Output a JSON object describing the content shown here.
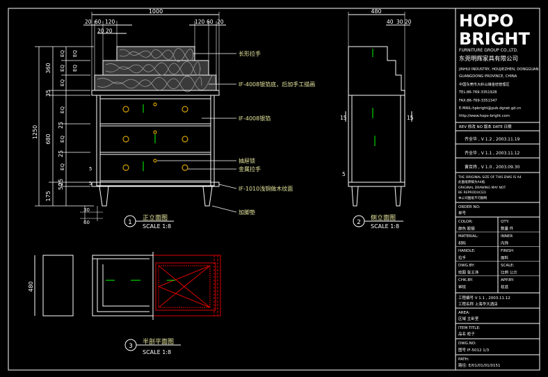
{
  "dims": {
    "front_top": "1000",
    "front_top_sub": [
      "20",
      "60",
      "120",
      "120",
      "60",
      "20"
    ],
    "front_top_sub2": [
      "20",
      "20"
    ],
    "front_left": [
      "EQ",
      "EQ",
      "EQ",
      "EQ",
      "EQ",
      "EQ",
      "EQ",
      "EQ"
    ],
    "front_left2": [
      "360",
      "35",
      "25",
      "25",
      "25",
      "50"
    ],
    "front_left3": [
      "1250",
      "680",
      "175"
    ],
    "front_bottom": [
      "30",
      "60"
    ],
    "front_inner": [
      "5",
      "5"
    ],
    "side_top": "480",
    "side_top_sub": [
      "40",
      "30",
      "20"
    ],
    "side_right": [
      "15",
      "15"
    ],
    "side_left": [
      "15",
      "5"
    ],
    "plan_left": "480"
  },
  "callouts": {
    "long_handle": "长形拉手",
    "veneer_top": "IF-4008银箔底，后加手工描画",
    "silver_foil": "IF-4008银箔",
    "drawer_lock": "抽屉锁",
    "metal_handle": "金属拉手",
    "leg_finish": "IF-1010浅铜做木纹面",
    "leg_pad": "加脚垫"
  },
  "views": {
    "front": {
      "num": "1",
      "title": "正立面图",
      "scale": "SCALE 1:8"
    },
    "side": {
      "num": "2",
      "title": "侧立面图",
      "scale": "SCALE 1:8"
    },
    "plan": {
      "num": "3",
      "title": "半剖平面图",
      "scale": "SCALE 1:8"
    }
  },
  "title_block": {
    "logo_line1": "HOPO",
    "logo_line2": "BRIGHT",
    "logo_sub": "FURNITURE GROUP CO.,LTD.",
    "company_cn": "东莞明辉家具有限公司",
    "addr_lines": [
      "JINHUI INDUSTRY, HOUJIEZHEN, DONGGUAN",
      "GUANGDONG PROVINCE, CHINA",
      "中国东莞市大岭山镇金桔管理区",
      "TEL:86-769-3351928",
      "FAX:86-769-3351347",
      "E-MAIL:hpbright@pub.dgnet.gd.cn",
      "http://www.hopo-bright.com"
    ],
    "rev_header": "REV 修改   NO 版本   DATE 日期",
    "revisions": [
      "齐全华  , V 1.2 , 2003.11.19",
      "齐全华  , V 1.1 , 2003.11.12",
      "黄百炜  , V 1.0 , 2003.09.30"
    ],
    "notes": [
      "THE ORIGINAL SIZE OF THIS DWG IS A4",
      "此图纸原稿为A4纸",
      "ORIGINAL DRAWING MAY NOT",
      "BE REPRODUCED",
      "本公司图纸不可翻制"
    ],
    "order_no": "ORDER NO:",
    "order_no_cn": "单号",
    "rows": [
      {
        "l": "COLOR:",
        "r": "QTY:"
      },
      {
        "l": "颜色   胶银",
        "r": "数量      件"
      },
      {
        "l": "MATERIAL:",
        "r": "INNER"
      },
      {
        "l": "材料",
        "r": "内饰"
      },
      {
        "l": "HANDLE:",
        "r": "FINISH"
      },
      {
        "l": "拉手",
        "r": "面料"
      },
      {
        "l": "DWG.BY:",
        "r": "SCALE:"
      },
      {
        "l": "绘图   张王泽",
        "r": "比例    公示"
      },
      {
        "l": "CHK.BY:",
        "r": "APP.BY:"
      },
      {
        "l": "审核",
        "r": "核准"
      }
    ],
    "project": "工程编号  V 1.1 , 2003.11.12",
    "project_sub": "工程名称  上海华大酒店",
    "area": "AREA:",
    "area_cn": "区域     主卧室",
    "item_title": "ITEM TITLE:",
    "item_title_cn": "品名     柜子",
    "dwg_no": "DWG.NO:",
    "dwg_no_cn": "图号      IF-5012     1/3",
    "path_label": "PATH:",
    "path_val": "路径:    E/01/01/01/0151"
  }
}
